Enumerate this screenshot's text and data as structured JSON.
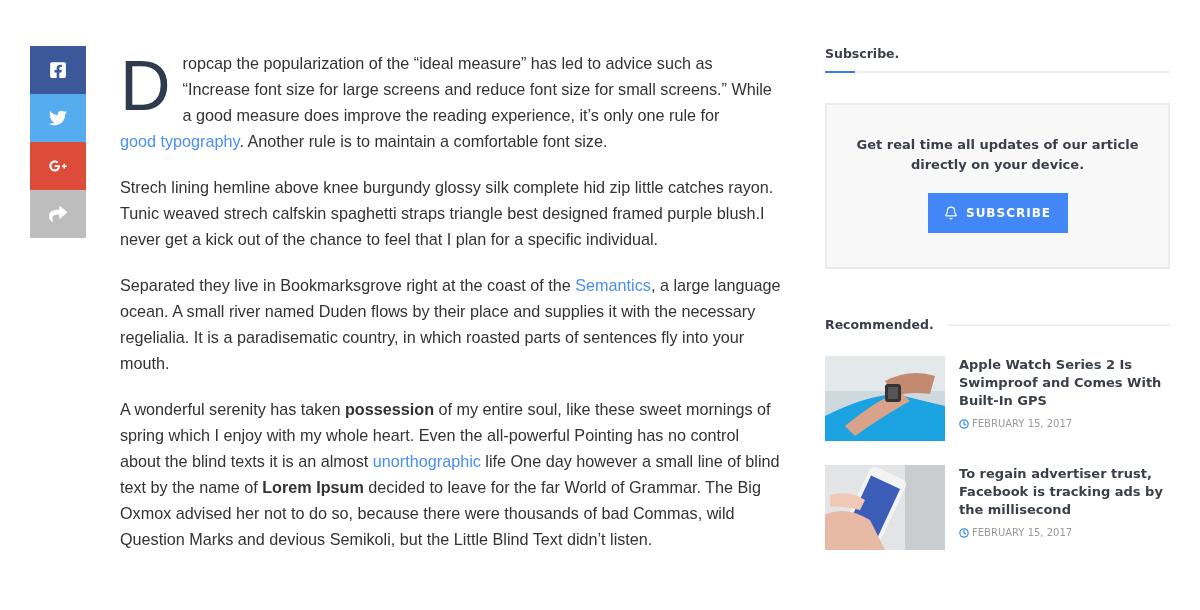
{
  "share_buttons": [
    {
      "kind": "facebook"
    },
    {
      "kind": "twitter"
    },
    {
      "kind": "googleplus"
    },
    {
      "kind": "share"
    }
  ],
  "article": {
    "dropcap": "D",
    "paragraphs": [
      [
        {
          "kind": "plain",
          "text": "ropcap the popularization of the “ideal measure” has led to advice such as “Increase font size for large screens and reduce font size for small screens.” While a good measure does improve the reading experience, it’s only one rule for "
        },
        {
          "kind": "link",
          "text": "good typography"
        },
        {
          "kind": "plain",
          "text": ". Another rule is to maintain a comfortable font size."
        }
      ],
      [
        {
          "kind": "plain",
          "text": "Strech lining hemline above knee burgundy glossy silk complete hid zip little catches rayon. Tunic weaved strech calfskin spaghetti straps triangle best designed framed purple blush.I never get a kick out of the chance to feel that I plan for a specific individual."
        }
      ],
      [
        {
          "kind": "plain",
          "text": "Separated they live in Bookmarksgrove right at the coast of the "
        },
        {
          "kind": "link",
          "text": "Semantics"
        },
        {
          "kind": "plain",
          "text": ", a large language ocean. A small river named Duden flows by their place and supplies it with the necessary regelialia. It is a paradisematic country, in which roasted parts of sentences fly into your mouth."
        }
      ],
      [
        {
          "kind": "plain",
          "text": "A wonderful serenity has taken **possession** of my entire soul, like these sweet mornings of spring which I enjoy with my whole heart. Even the all-powerful Pointing has no control about the blind texts it is an almost "
        },
        {
          "kind": "link",
          "text": "unorthographic"
        },
        {
          "kind": "plain",
          "text": " life One day however a small line of blind text by the name of **Lorem Ipsum** decided to leave for the far World of Grammar. The Big Oxmox advised her not to do so, because there were thousands of bad Commas, wild Question Marks and devious Semikoli, but the Little Blind Text didn’t listen."
        }
      ]
    ]
  },
  "sidebar": {
    "subscribe": {
      "heading": "Subscribe.",
      "text": "Get real time all updates of our article directly on your device.",
      "button": "SUBSCRIBE"
    },
    "recommended": {
      "heading": "Recommended.",
      "posts": [
        {
          "title": "Apple Watch Series 2 Is Swimproof and Comes With Built-In GPS",
          "date": "FEBRUARY 15, 2017",
          "kind": "watch"
        },
        {
          "title": "To regain advertiser trust, Facebook is tracking ads by the millisecond",
          "date": "FEBRUARY 15, 2017",
          "kind": "phone"
        }
      ]
    }
  }
}
